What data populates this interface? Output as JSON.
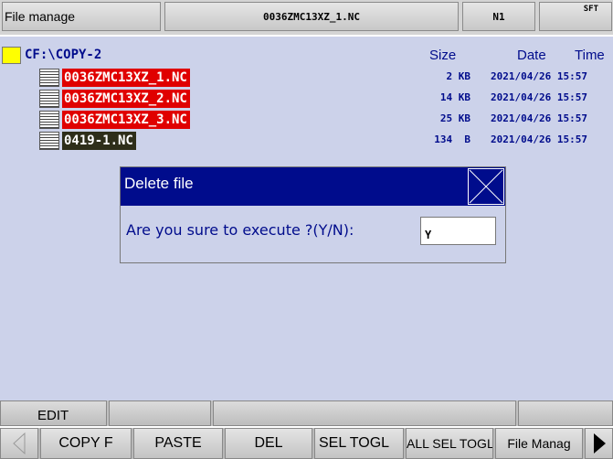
{
  "topbar": {
    "title": "File manage",
    "current_file": "0036ZMC13XZ_1.NC",
    "channel": "N1",
    "shift": "SFT"
  },
  "browser": {
    "path": "CF:\\COPY-2",
    "headers": {
      "size": "Size",
      "date": "Date",
      "time": "Time"
    },
    "files": [
      {
        "name": "0036ZMC13XZ_1.NC",
        "size": "2 KB",
        "datetime": "2021/04/26 15:57",
        "highlight": "#e00000"
      },
      {
        "name": "0036ZMC13XZ_2.NC",
        "size": "14 KB",
        "datetime": "2021/04/26 15:57",
        "highlight": "#e00000"
      },
      {
        "name": "0036ZMC13XZ_3.NC",
        "size": "25 KB",
        "datetime": "2021/04/26 15:57",
        "highlight": "#e00000"
      },
      {
        "name": "0419-1.NC",
        "size": "134  B",
        "datetime": "2021/04/26 15:57",
        "highlight": "#2e2e1a"
      }
    ]
  },
  "dialog": {
    "title": "Delete file",
    "prompt": "Are you sure to execute ?(Y/N):",
    "input_value": "Y",
    "close_icon": "close-x-icon"
  },
  "statusbar": {
    "mode": "EDIT"
  },
  "softkeys": {
    "prev_icon": "arrow-left-icon",
    "next_icon": "arrow-right-icon",
    "labels": [
      "COPY F",
      "PASTE",
      "DEL",
      "SEL TOGL",
      "ALL SEL TOGL",
      "File Manag"
    ]
  },
  "colors": {
    "accent_blue": "#000c8c",
    "background": "#ccd2ea",
    "selection_red": "#e00000",
    "folder_yellow": "#ffff00"
  }
}
